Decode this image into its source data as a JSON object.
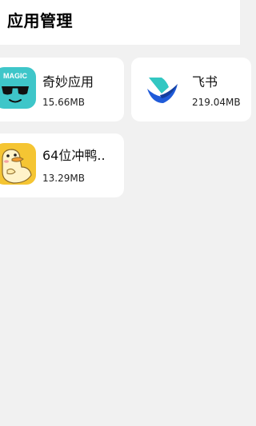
{
  "header": {
    "title": "应用管理"
  },
  "apps": [
    {
      "name": "奇妙应用",
      "size": "15.66MB",
      "icon": "magic-sunglasses-icon",
      "icon_text": "MAGIC",
      "color": "#3ec6c9"
    },
    {
      "name": "飞书",
      "size": "219.04MB",
      "icon": "feishu-bird-icon",
      "color": "#1f5bd9"
    },
    {
      "name": "64位冲鸭..",
      "size": "13.29MB",
      "icon": "duck-icon",
      "color": "#f5c533"
    }
  ]
}
